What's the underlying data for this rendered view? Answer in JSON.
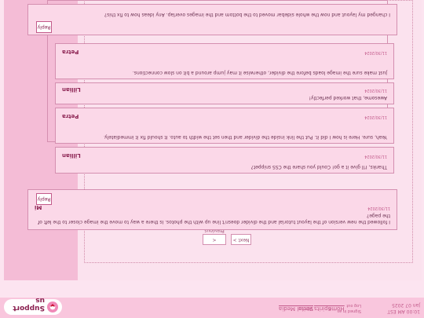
{
  "header": {
    "logo_text": "Support us",
    "nav": [
      "Home",
      "Spirits",
      "Write",
      "Social Media"
    ],
    "user_time_lines": [
      "10:00 AM EST",
      "Jan 07 2025"
    ],
    "meta_lines": [
      "Signed in as ...",
      "Log out"
    ]
  },
  "pager": {
    "prev": "< Previous",
    "next": "Next >"
  },
  "posts": {
    "p1": {
      "text": "I followed the new version of the layout tutorial and the divider doesn't line up with the photos. Is there a way to move the image closer to the left of the page?",
      "name": "Mi",
      "date": "11/30/2024",
      "reply": "Reply"
    },
    "p2": {
      "text": "Thanks, I'll give it a go! Could you share the CSS snippet?",
      "name": "Lillian",
      "date": "11/30/2024"
    },
    "p3": {
      "text": "Yeah, sure. Here is how I did it. Put the link inside the divider and then set the width to auto. It should fix it immediately.",
      "name": "Petra",
      "date": "11/30/2024"
    },
    "p4": {
      "text": "Awesome, that worked perfectly!",
      "name": "Lillian",
      "date": "11/30/2024"
    },
    "p5": {
      "text": "Just make sure the image loads before the divider, otherwise it may jump around a bit on slow connections.",
      "name": "Petra",
      "date": "11/30/2024"
    },
    "p6": {
      "text": "I changed my layout and now the whole sidebar moved to the bottom and the images overlap. Any ideas how to fix this?",
      "reply": "Reply"
    }
  },
  "colors": {
    "bg": "#fce4f0",
    "sidebar": "#f4bcd6",
    "panel": "#fbd8e8",
    "accent": "#c25a8a",
    "dark": "#8a2050"
  }
}
